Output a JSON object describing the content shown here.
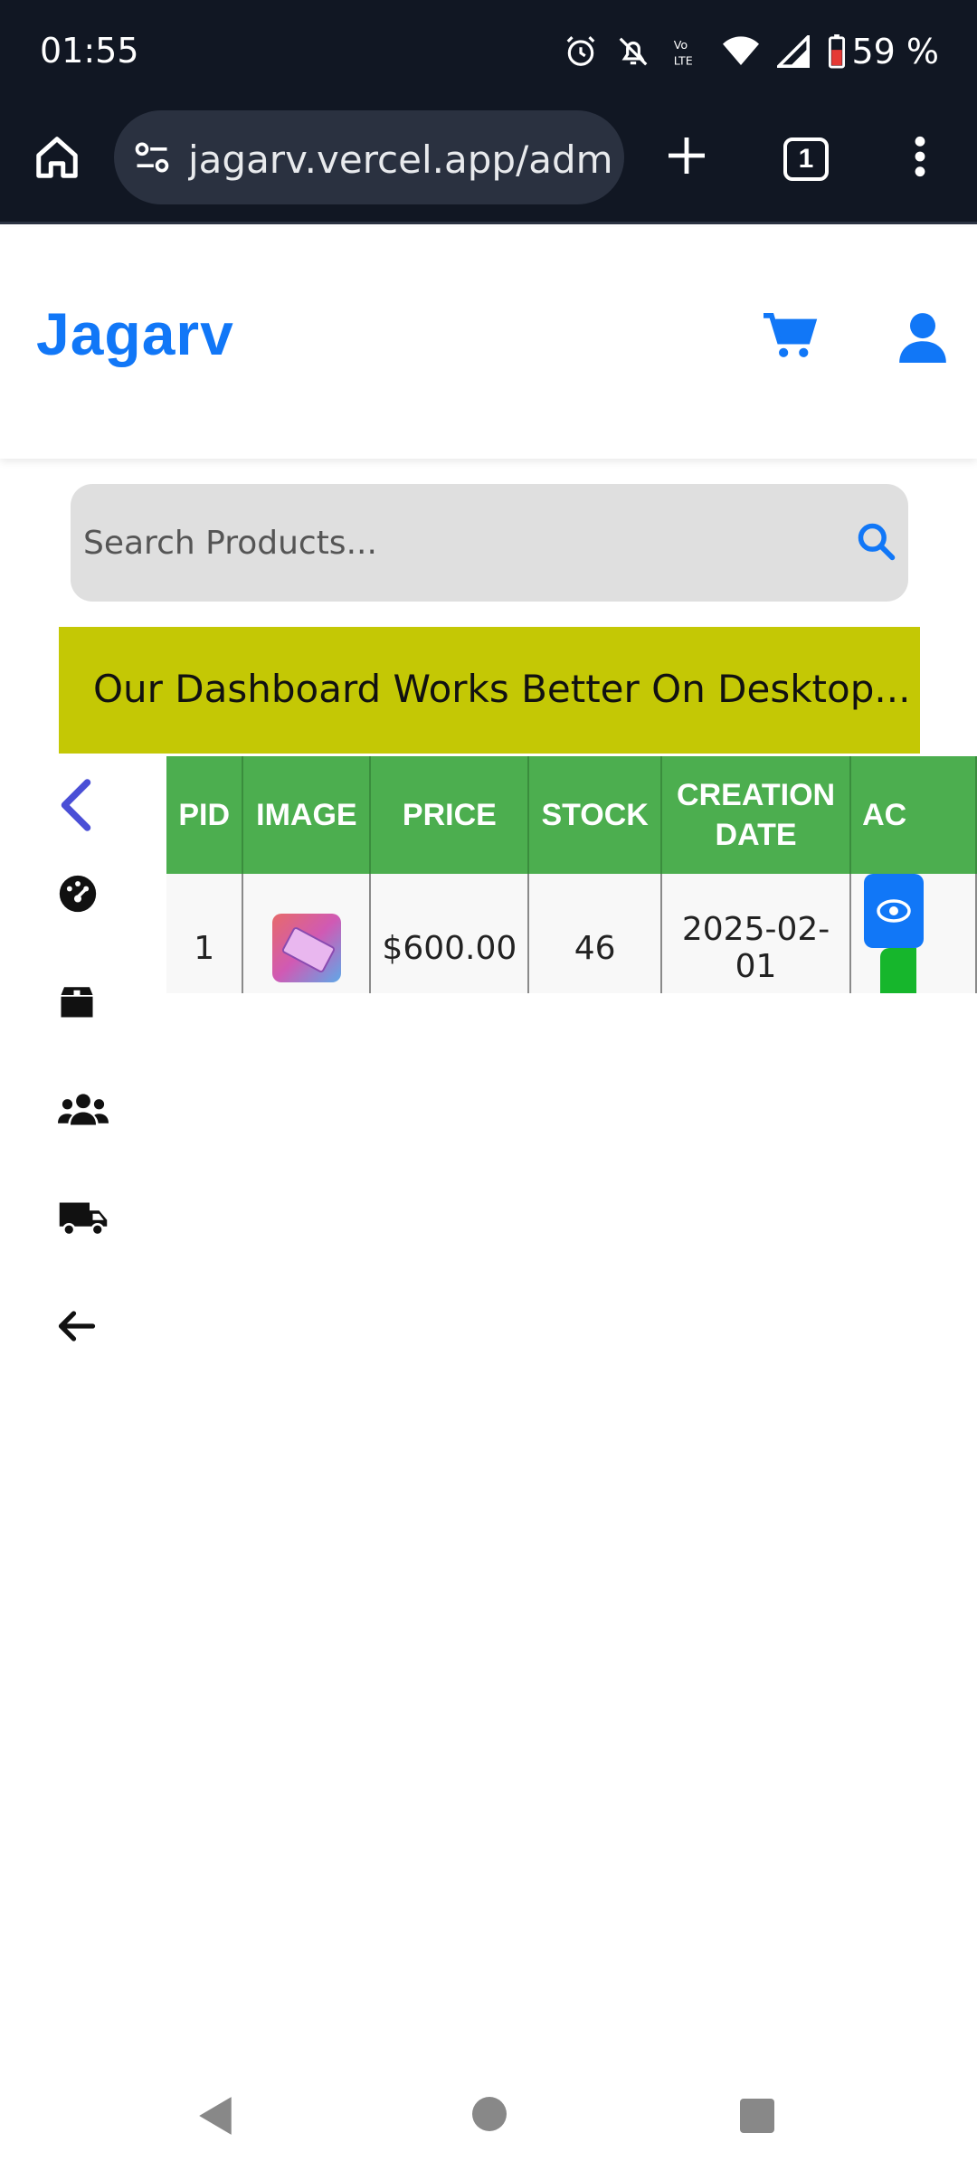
{
  "status_bar": {
    "time": "01:55",
    "battery": "59 %",
    "icons": [
      "alarm-icon",
      "bell-off-icon",
      "volte-icon",
      "wifi-icon",
      "signal-icon",
      "battery-icon"
    ]
  },
  "browser": {
    "url": "jagarv.vercel.app/admin/",
    "tab_count": "1"
  },
  "header": {
    "logo": "Jagarv",
    "brand_color": "#1177f7"
  },
  "search": {
    "placeholder": "Search Products..."
  },
  "banner": {
    "text": "Our Dashboard Works Better On Desktop..."
  },
  "sidebar": {
    "items": [
      "back-chevron-icon",
      "dashboard-icon",
      "products-box-icon",
      "users-icon",
      "delivery-truck-icon",
      "logout-arrow-icon"
    ]
  },
  "table": {
    "headers": [
      "PID",
      "IMAGE",
      "PRICE",
      "STOCK",
      "CREATION DATE",
      "AC"
    ],
    "rows": [
      {
        "pid": "1",
        "image": "product-thumbnail",
        "price": "$600.00",
        "stock": "46",
        "date": "2025-02-01"
      }
    ]
  }
}
